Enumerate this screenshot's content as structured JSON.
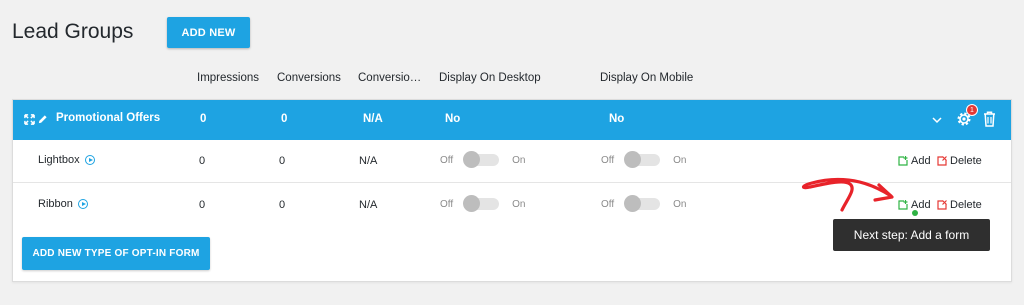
{
  "page": {
    "title": "Lead Groups",
    "add_new_label": "ADD NEW"
  },
  "columns": {
    "impressions": "Impressions",
    "conversions": "Conversions",
    "conversion_rate": "Conversio…",
    "display_desktop": "Display On Desktop",
    "display_mobile": "Display On Mobile"
  },
  "group": {
    "name": "Promotional Offers",
    "impressions": "0",
    "conversions": "0",
    "conversion_rate": "N/A",
    "display_desktop": "No",
    "display_mobile": "No",
    "settings_badge": "1"
  },
  "rows": [
    {
      "name": "Lightbox",
      "impressions": "0",
      "conversions": "0",
      "conversion_rate": "N/A",
      "desktop_off": "Off",
      "desktop_on": "On",
      "mobile_off": "Off",
      "mobile_on": "On",
      "add_label": "Add",
      "delete_label": "Delete"
    },
    {
      "name": "Ribbon",
      "impressions": "0",
      "conversions": "0",
      "conversion_rate": "N/A",
      "desktop_off": "Off",
      "desktop_on": "On",
      "mobile_off": "Off",
      "mobile_on": "On",
      "add_label": "Add",
      "delete_label": "Delete"
    }
  ],
  "add_optin_label": "ADD NEW TYPE OF OPT-IN FORM",
  "tooltip": "Next step: Add a form",
  "colors": {
    "accent": "#1ea3e2",
    "delete": "#e53935",
    "add": "#2fb344",
    "annotation_arrow": "#e8232a"
  }
}
